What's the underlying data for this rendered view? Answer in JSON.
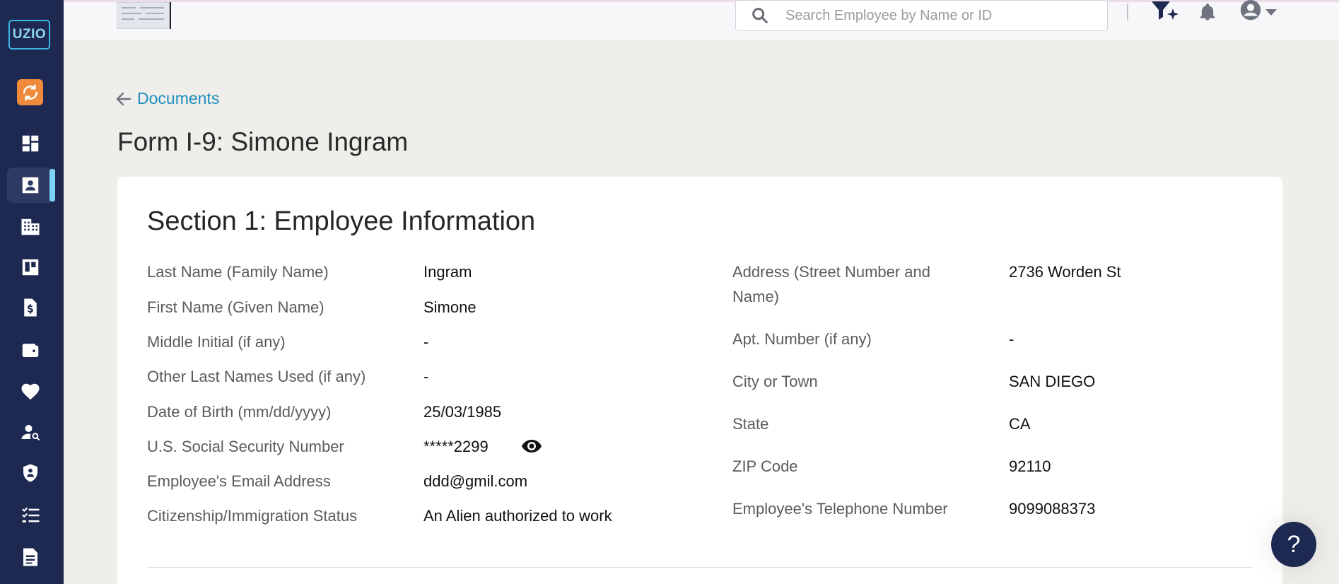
{
  "sidebar": {
    "logo": "UZIO",
    "items": [
      {
        "name": "dashboard-icon"
      },
      {
        "name": "employee-profile-icon",
        "active": true
      },
      {
        "name": "company-building-icon"
      },
      {
        "name": "boards-icon"
      },
      {
        "name": "payroll-document-icon"
      },
      {
        "name": "wallet-icon"
      },
      {
        "name": "benefits-heart-icon"
      },
      {
        "name": "people-search-icon"
      },
      {
        "name": "compliance-shield-icon"
      },
      {
        "name": "checklist-icon"
      },
      {
        "name": "reports-document-icon"
      }
    ]
  },
  "header": {
    "search_placeholder": "Search Employee by Name or ID"
  },
  "breadcrumb": {
    "back_label": "Documents"
  },
  "page": {
    "title": "Form I-9: Simone Ingram"
  },
  "section": {
    "title": "Section 1: Employee Information",
    "left_fields": [
      {
        "label": "Last Name (Family Name)",
        "value": "Ingram"
      },
      {
        "label": "First Name (Given Name)",
        "value": "Simone"
      },
      {
        "label": "Middle Initial (if any)",
        "value": "-"
      },
      {
        "label": "Other Last Names Used (if any)",
        "value": "-"
      },
      {
        "label": "Date of Birth (mm/dd/yyyy)",
        "value": "25/03/1985"
      },
      {
        "label": "U.S. Social Security Number",
        "value": "*****2299"
      },
      {
        "label": "Employee's Email Address",
        "value": "ddd@gmil.com"
      },
      {
        "label": "Citizenship/Immigration Status",
        "value": "An Alien authorized to work"
      }
    ],
    "right_fields": [
      {
        "label": "Address (Street Number and Name)",
        "value": "2736 Worden St"
      },
      {
        "label": "Apt. Number (if any)",
        "value": "-"
      },
      {
        "label": "City or Town",
        "value": "SAN DIEGO"
      },
      {
        "label": "State",
        "value": "CA"
      },
      {
        "label": "ZIP Code",
        "value": "92110"
      },
      {
        "label": "Employee's Telephone Number",
        "value": "9099088373"
      }
    ]
  },
  "help": {
    "label": "?"
  },
  "colors": {
    "sidebar": "#1d2951",
    "accent_link": "#1e8fbf",
    "active_indicator": "#7ad3f4",
    "sync_orange": "#f08a3c",
    "page_background": "#f0eeea"
  }
}
